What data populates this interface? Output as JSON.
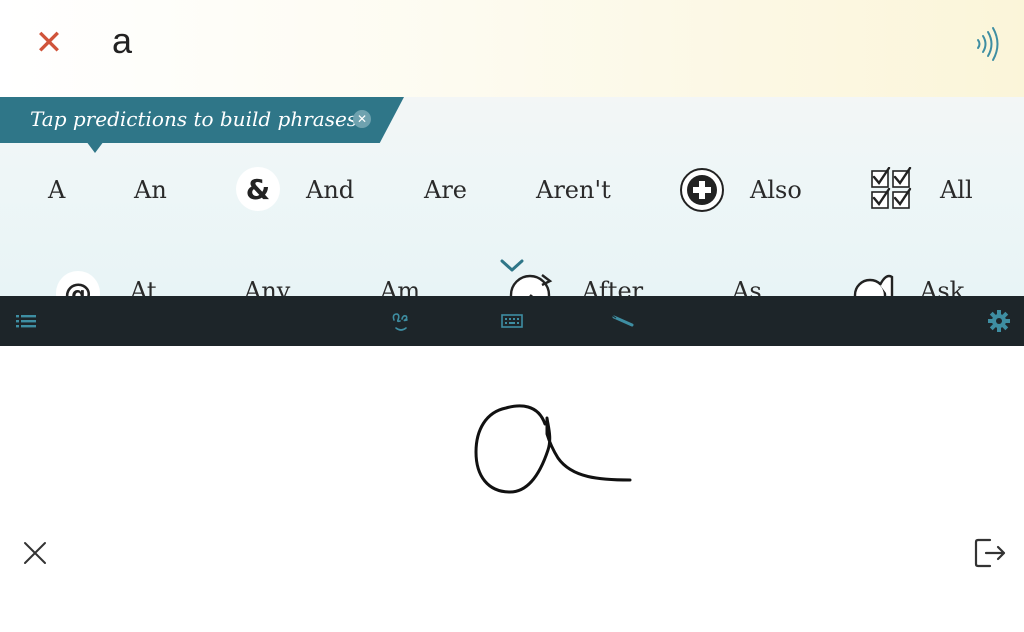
{
  "input": {
    "text": "a"
  },
  "icons": {
    "clear": "close-icon",
    "speak": "speaker-icon",
    "list": "list-icon",
    "handwriting": "handwriting-icon",
    "keyboard": "keyboard-icon",
    "pen": "pen-icon",
    "settings": "gear-icon",
    "exit": "exit-icon"
  },
  "tip": {
    "text": "Tap predictions to build phrases."
  },
  "predictions": {
    "row1": [
      "A",
      "An",
      "And",
      "Are",
      "Aren't",
      "Also",
      "All"
    ],
    "row2": [
      "At",
      "Any",
      "Am",
      "After",
      "As",
      "Ask"
    ]
  },
  "colors": {
    "accent": "#2f7688",
    "toolbar_bg": "#1d2529",
    "toolbar_icon": "#3e8ea2",
    "clear": "#d0533a"
  }
}
